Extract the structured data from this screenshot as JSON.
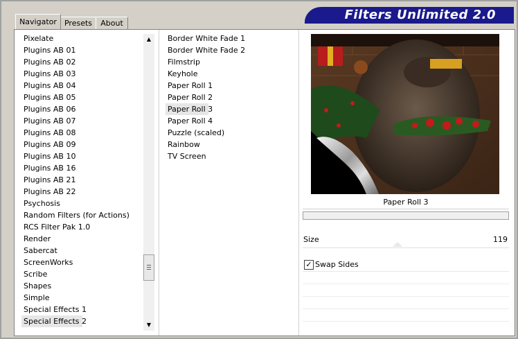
{
  "app": {
    "title": "Filters Unlimited 2.0"
  },
  "tabs": [
    {
      "label": "Navigator",
      "active": true
    },
    {
      "label": "Presets",
      "active": false
    },
    {
      "label": "About",
      "active": false
    }
  ],
  "categories": {
    "items": [
      "Pixelate",
      "Plugins AB 01",
      "Plugins AB 02",
      "Plugins AB 03",
      "Plugins AB 04",
      "Plugins AB 05",
      "Plugins AB 06",
      "Plugins AB 07",
      "Plugins AB 08",
      "Plugins AB 09",
      "Plugins AB 10",
      "Plugins AB 16",
      "Plugins AB 21",
      "Plugins AB 22",
      "Psychosis",
      "Random Filters (for Actions)",
      "RCS Filter Pak 1.0",
      "Render",
      "Sabercat",
      "ScreenWorks",
      "Scribe",
      "Shapes",
      "Simple",
      "Special Effects 1",
      "Special Effects 2"
    ],
    "selected": "Special Effects 2"
  },
  "filters": {
    "items": [
      "Border White Fade 1",
      "Border White Fade 2",
      "Filmstrip",
      "Keyhole",
      "Paper Roll 1",
      "Paper Roll 2",
      "Paper Roll 3",
      "Paper Roll 4",
      "Puzzle (scaled)",
      "Rainbow",
      "TV Screen"
    ],
    "selected": "Paper Roll 3"
  },
  "preview": {
    "label": "Paper Roll 3"
  },
  "controls": {
    "size_label": "Size",
    "size_value": "119",
    "swap_sides_label": "Swap Sides",
    "swap_sides_checked": true,
    "checkmark": "✓"
  }
}
